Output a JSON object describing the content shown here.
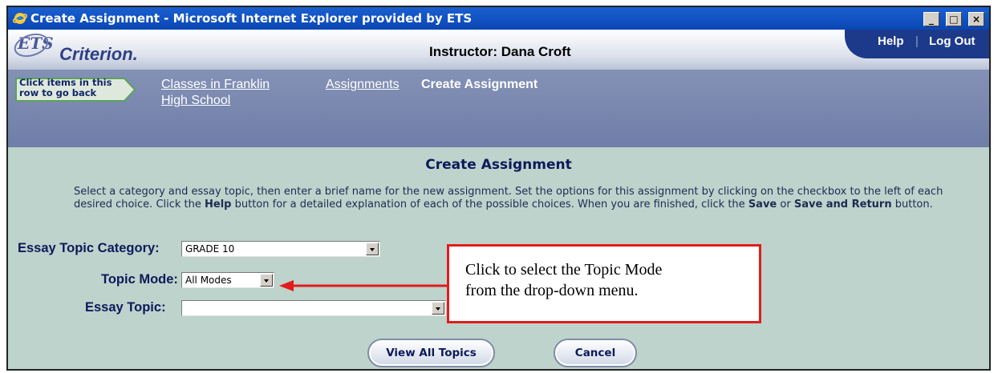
{
  "window": {
    "title": "Create Assignment - Microsoft Internet Explorer provided by ETS",
    "controls": {
      "minimize": "_",
      "maximize": "□",
      "close": "×"
    }
  },
  "brand": {
    "ets": "ETS",
    "product": "Criterion.",
    "instructor": "Instructor: Dana Croft",
    "help": "Help",
    "separator": "|",
    "logout": "Log Out"
  },
  "nav": {
    "back_hint_line1": "Click items in this",
    "back_hint_line2": "row to go back",
    "crumb_classes_line1": "Classes in Franklin",
    "crumb_classes_line2": "High School",
    "crumb_assignments": "Assignments",
    "crumb_current": "Create Assignment"
  },
  "main": {
    "heading": "Create Assignment",
    "instructions": {
      "part1": "Select a category and essay topic, then enter a brief name for the new assignment. Set the options for this assignment by clicking on the checkbox to the left of each desired choice. Click the ",
      "help_word": "Help",
      "part2": " button for a detailed explanation of each of the possible choices. When you are finished, click the ",
      "save_word": "Save",
      "part3": " or ",
      "save_return_word": "Save and Return",
      "part4": " button."
    }
  },
  "form": {
    "category_label": "Essay Topic Category:",
    "category_value": "GRADE 10",
    "mode_label": "Topic Mode:",
    "mode_value": "All Modes",
    "topic_label": "Essay Topic:",
    "topic_value": ""
  },
  "callout": {
    "line1": "Click to select the Topic Mode",
    "line2": "from the drop-down menu.",
    "color": "#e21c1c"
  },
  "buttons": {
    "view_all": "View All Topics",
    "cancel": "Cancel"
  },
  "colors": {
    "titlebar": "#0a46b4",
    "navbar": "#7a88b0",
    "content_bg": "#bdd3cc",
    "help_tab": "#1d3a8a"
  }
}
